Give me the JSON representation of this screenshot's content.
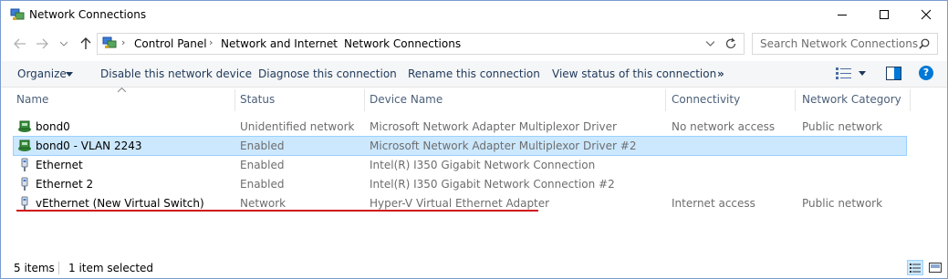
{
  "window": {
    "title": "Network Connections"
  },
  "address": {
    "breadcrumbs": [
      "Control Panel",
      "Network and Internet",
      "Network Connections"
    ]
  },
  "search": {
    "placeholder": "Search Network Connections"
  },
  "toolbar": {
    "organize": "Organize",
    "disable": "Disable this network device",
    "diagnose": "Diagnose this connection",
    "rename": "Rename this connection",
    "view_status": "View status of this connection",
    "more": "»"
  },
  "columns": [
    "Name",
    "Status",
    "Device Name",
    "Connectivity",
    "Network Category"
  ],
  "rows": [
    {
      "name": "bond0",
      "status": "Unidentified network",
      "device": "Microsoft Network Adapter Multiplexor Driver",
      "connectivity": "No network access",
      "category": "Public network",
      "icon": "network-adapter-icon",
      "selected": false
    },
    {
      "name": "bond0 - VLAN 2243",
      "status": "Enabled",
      "device": "Microsoft Network Adapter Multiplexor Driver #2",
      "connectivity": "",
      "category": "",
      "icon": "network-adapter-icon",
      "selected": true
    },
    {
      "name": "Ethernet",
      "status": "Enabled",
      "device": "Intel(R) I350 Gigabit Network Connection",
      "connectivity": "",
      "category": "",
      "icon": "ethernet-plug-icon",
      "selected": false
    },
    {
      "name": "Ethernet 2",
      "status": "Enabled",
      "device": "Intel(R) I350 Gigabit Network Connection #2",
      "connectivity": "",
      "category": "",
      "icon": "ethernet-plug-icon",
      "selected": false
    },
    {
      "name": "vEthernet (New Virtual Switch)",
      "status": "Network",
      "device": "Hyper-V Virtual Ethernet Adapter",
      "connectivity": "Internet access",
      "category": "Public network",
      "icon": "ethernet-plug-icon",
      "selected": false
    }
  ],
  "status": {
    "items": "5 items",
    "selected": "1 item selected"
  },
  "colors": {
    "selection": "#cce8ff",
    "accent": "#0078d7",
    "underline": "#d10f1a"
  }
}
